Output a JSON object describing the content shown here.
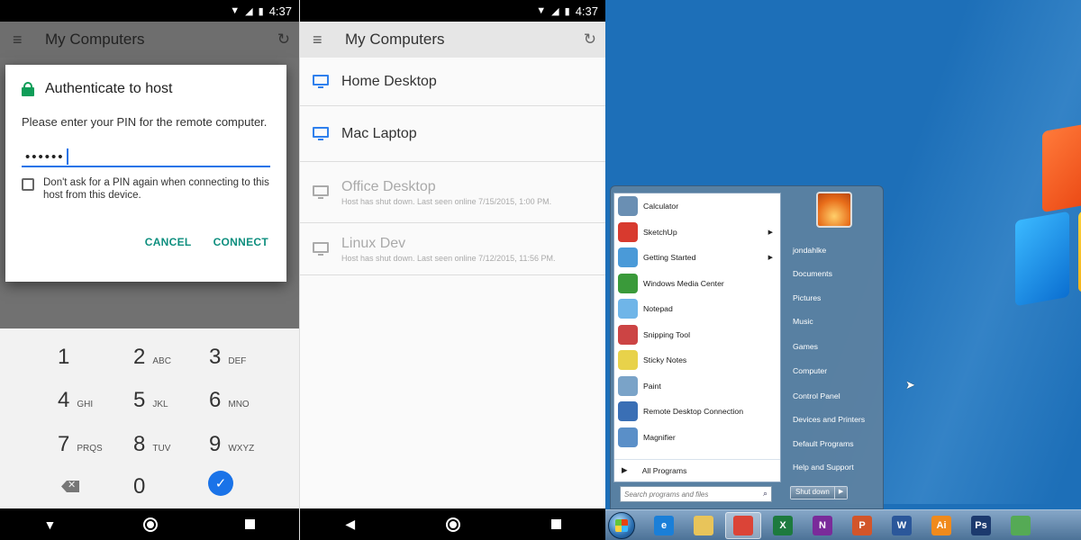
{
  "status_bar": {
    "time": "4:37"
  },
  "panel1": {
    "app_title": "My Computers",
    "dialog": {
      "title": "Authenticate to host",
      "message": "Please enter your PIN for the remote computer.",
      "pin_value": "••••••",
      "checkbox_label": "Don't ask for a PIN again when connecting to this host from this device.",
      "checkbox_checked": false,
      "cancel_label": "CANCEL",
      "connect_label": "CONNECT"
    },
    "keypad": [
      {
        "num": "1",
        "letters": ""
      },
      {
        "num": "2",
        "letters": "ABC"
      },
      {
        "num": "3",
        "letters": "DEF"
      },
      {
        "num": "4",
        "letters": "GHI"
      },
      {
        "num": "5",
        "letters": "JKL"
      },
      {
        "num": "6",
        "letters": "MNO"
      },
      {
        "num": "7",
        "letters": "PRQS"
      },
      {
        "num": "8",
        "letters": "TUV"
      },
      {
        "num": "9",
        "letters": "WXYZ"
      },
      {
        "num": "0",
        "letters": ""
      }
    ]
  },
  "panel2": {
    "app_title": "My Computers",
    "hosts": [
      {
        "name": "Home Desktop",
        "status": "",
        "online": true
      },
      {
        "name": "Mac Laptop",
        "status": "",
        "online": true
      },
      {
        "name": "Office Desktop",
        "status": "Host has shut down. Last seen online 7/15/2015, 1:00 PM.",
        "online": false
      },
      {
        "name": "Linux Dev",
        "status": "Host has shut down. Last seen online 7/12/2015, 11:56 PM.",
        "online": false
      }
    ]
  },
  "windows": {
    "start_menu": {
      "programs": [
        {
          "label": "Calculator",
          "icon": "calculator-icon",
          "color": "#6a8fb3",
          "has_submenu": false
        },
        {
          "label": "SketchUp",
          "icon": "sketchup-icon",
          "color": "#d83a2e",
          "has_submenu": true
        },
        {
          "label": "Getting Started",
          "icon": "getting-started-icon",
          "color": "#4a9ad8",
          "has_submenu": true
        },
        {
          "label": "Windows Media Center",
          "icon": "media-center-icon",
          "color": "#3a9a3a",
          "has_submenu": false
        },
        {
          "label": "Notepad",
          "icon": "notepad-icon",
          "color": "#6fb5e8",
          "has_submenu": false
        },
        {
          "label": "Snipping Tool",
          "icon": "snipping-tool-icon",
          "color": "#c44",
          "has_submenu": false
        },
        {
          "label": "Sticky Notes",
          "icon": "sticky-notes-icon",
          "color": "#e8d24a",
          "has_submenu": false
        },
        {
          "label": "Paint",
          "icon": "paint-icon",
          "color": "#7aa3c8",
          "has_submenu": false
        },
        {
          "label": "Remote Desktop Connection",
          "icon": "remote-desktop-icon",
          "color": "#3a6fb5",
          "has_submenu": false
        },
        {
          "label": "Magnifier",
          "icon": "magnifier-icon",
          "color": "#5a8fc8",
          "has_submenu": false
        }
      ],
      "all_programs_label": "All Programs",
      "search_placeholder": "Search programs and files",
      "right_links": [
        "jondahlke",
        "Documents",
        "Pictures",
        "Music",
        "Games",
        "Computer",
        "Control Panel",
        "Devices and Printers",
        "Default Programs",
        "Help and Support"
      ],
      "shutdown_label": "Shut down"
    },
    "taskbar": [
      {
        "icon": "internet-explorer-icon",
        "color": "#1a7fd8",
        "glyph": "e",
        "active": false
      },
      {
        "icon": "file-explorer-icon",
        "color": "#e8c45a",
        "glyph": "",
        "active": false
      },
      {
        "icon": "chrome-icon",
        "color": "#db4437",
        "glyph": "",
        "active": true
      },
      {
        "icon": "excel-icon",
        "color": "#1d7a3e",
        "glyph": "X",
        "active": false
      },
      {
        "icon": "onenote-icon",
        "color": "#7a2b9a",
        "glyph": "N",
        "active": false
      },
      {
        "icon": "powerpoint-icon",
        "color": "#d2552a",
        "glyph": "P",
        "active": false
      },
      {
        "icon": "word-icon",
        "color": "#2b579a",
        "glyph": "W",
        "active": false
      },
      {
        "icon": "illustrator-icon",
        "color": "#f08a1c",
        "glyph": "Ai",
        "active": false
      },
      {
        "icon": "photoshop-icon",
        "color": "#1c3a6e",
        "glyph": "Ps",
        "active": false
      },
      {
        "icon": "evernote-icon",
        "color": "#5a5",
        "glyph": "",
        "active": false
      }
    ]
  }
}
